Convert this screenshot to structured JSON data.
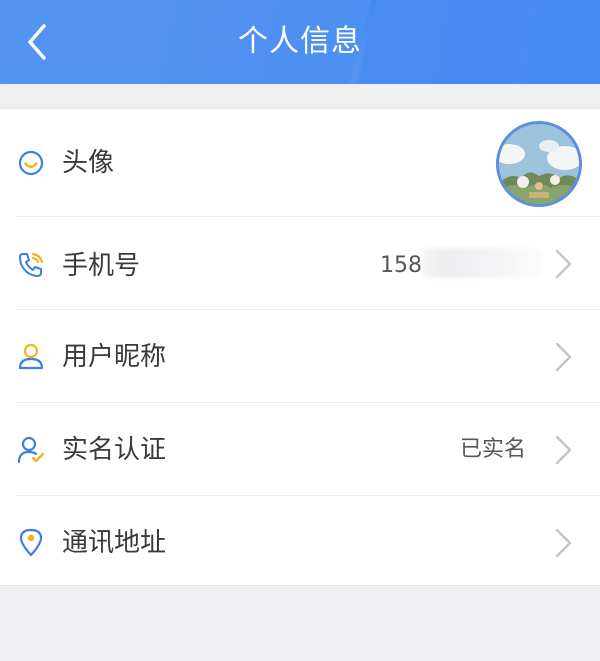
{
  "header": {
    "title": "个人信息"
  },
  "rows": [
    {
      "label": "头像",
      "value": "",
      "icon": "smile-circle-icon"
    },
    {
      "label": "手机号",
      "value": "158",
      "icon": "phone-icon"
    },
    {
      "label": "用户昵称",
      "value": "",
      "icon": "user-icon"
    },
    {
      "label": "实名认证",
      "value": "已实名",
      "icon": "user-verified-icon"
    },
    {
      "label": "通讯地址",
      "value": "",
      "icon": "location-pin-icon"
    }
  ],
  "colors": {
    "header_blue": "#4d8ff2",
    "icon_blue": "#3b7fe8",
    "icon_yellow": "#f2b51c",
    "chevron": "#c4c4c6"
  }
}
